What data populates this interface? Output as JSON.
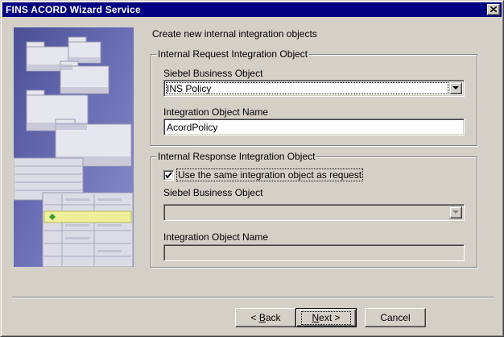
{
  "window": {
    "title": "FINS ACORD Wizard Service"
  },
  "main": {
    "heading": "Create new internal integration objects",
    "request_group": {
      "legend": "Internal Request Integration Object",
      "business_object_label": "Siebel Business Object",
      "business_object_value": "INS Policy",
      "integration_name_label": "Integration Object Name",
      "integration_name_value": "AcordPolicy"
    },
    "response_group": {
      "legend": "Internal Response Integration Object",
      "same_as_request_label": "Use the same integration object as request",
      "same_as_request_checked": true,
      "business_object_label": "Siebel Business Object",
      "business_object_value": "",
      "integration_name_label": "Integration Object Name",
      "integration_name_value": ""
    }
  },
  "buttons": {
    "back": {
      "prefix": "< ",
      "accel": "B",
      "rest": "ack"
    },
    "next": {
      "accel": "N",
      "rest": "ext >"
    },
    "cancel": "Cancel"
  },
  "icons": {
    "close": "close-icon",
    "dropdown": "chevron-down-icon",
    "check": "checkmark-icon",
    "wizard_art": "wizard-illustration"
  }
}
